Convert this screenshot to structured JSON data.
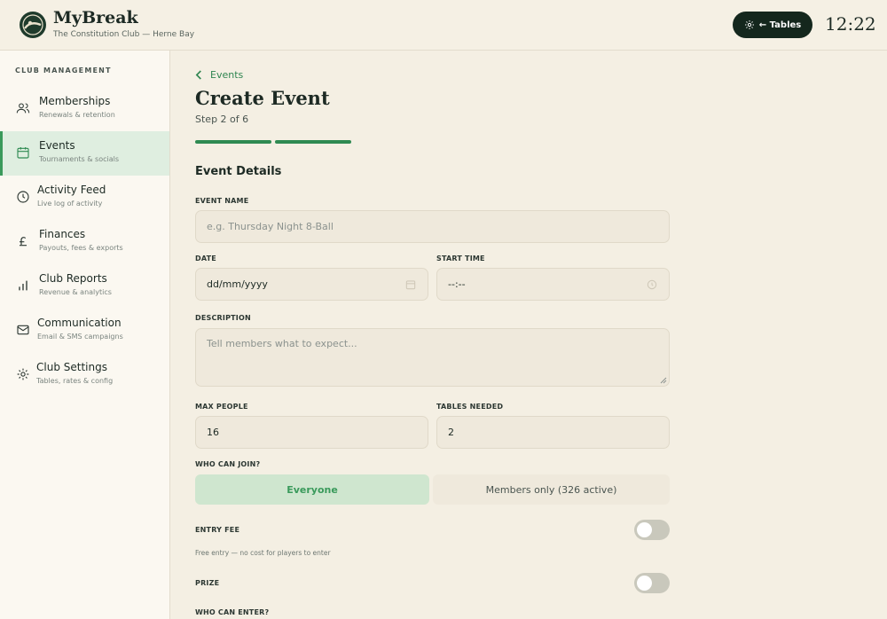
{
  "header": {
    "brand": "MyBreak",
    "club": "The Constitution Club — Herne Bay",
    "tables_button": "← Tables",
    "clock": "12:22"
  },
  "sidebar": {
    "heading": "CLUB MANAGEMENT",
    "items": [
      {
        "label": "Memberships",
        "sub": "Renewals & retention",
        "icon": "users-icon"
      },
      {
        "label": "Events",
        "sub": "Tournaments & socials",
        "icon": "calendar-icon",
        "active": true
      },
      {
        "label": "Activity Feed",
        "sub": "Live log of activity",
        "icon": "clock-icon"
      },
      {
        "label": "Finances",
        "sub": "Payouts, fees & exports",
        "icon": "pound-icon"
      },
      {
        "label": "Club Reports",
        "sub": "Revenue & analytics",
        "icon": "bar-chart-icon"
      },
      {
        "label": "Communication",
        "sub": "Email & SMS campaigns",
        "icon": "mail-icon"
      },
      {
        "label": "Club Settings",
        "sub": "Tables, rates & config",
        "icon": "gear-icon"
      }
    ]
  },
  "main": {
    "back_label": "Events",
    "title": "Create Event",
    "step": "Step 2 of 6",
    "progress": {
      "completed_steps": 2,
      "total_steps": 6
    },
    "section_title": "Event Details",
    "event_name": {
      "label": "EVENT NAME",
      "placeholder": "e.g. Thursday Night 8-Ball",
      "value": ""
    },
    "date": {
      "label": "DATE",
      "placeholder": "dd/mm/yyyy"
    },
    "start_time": {
      "label": "START TIME",
      "placeholder": "--:--"
    },
    "description": {
      "label": "DESCRIPTION",
      "placeholder": "Tell members what to expect..."
    },
    "max_people": {
      "label": "MAX PEOPLE",
      "value": "16"
    },
    "tables_needed": {
      "label": "TABLES NEEDED",
      "value": "2"
    },
    "who_can_join": {
      "label": "WHO CAN JOIN?",
      "options": [
        "Everyone",
        "Members only (326 active)"
      ],
      "selected": "Everyone"
    },
    "entry_fee": {
      "label": "ENTRY FEE",
      "enabled": false,
      "hint": "Free entry — no cost for players to enter"
    },
    "prize": {
      "label": "PRIZE",
      "enabled": false
    },
    "who_can_enter": {
      "label": "WHO CAN ENTER?"
    }
  },
  "colors": {
    "background": "#f4efe3",
    "accent": "#2f8a52",
    "dark": "#14271d",
    "active_nav": "#dfeee0",
    "selected_option": "#cfe6cf"
  }
}
